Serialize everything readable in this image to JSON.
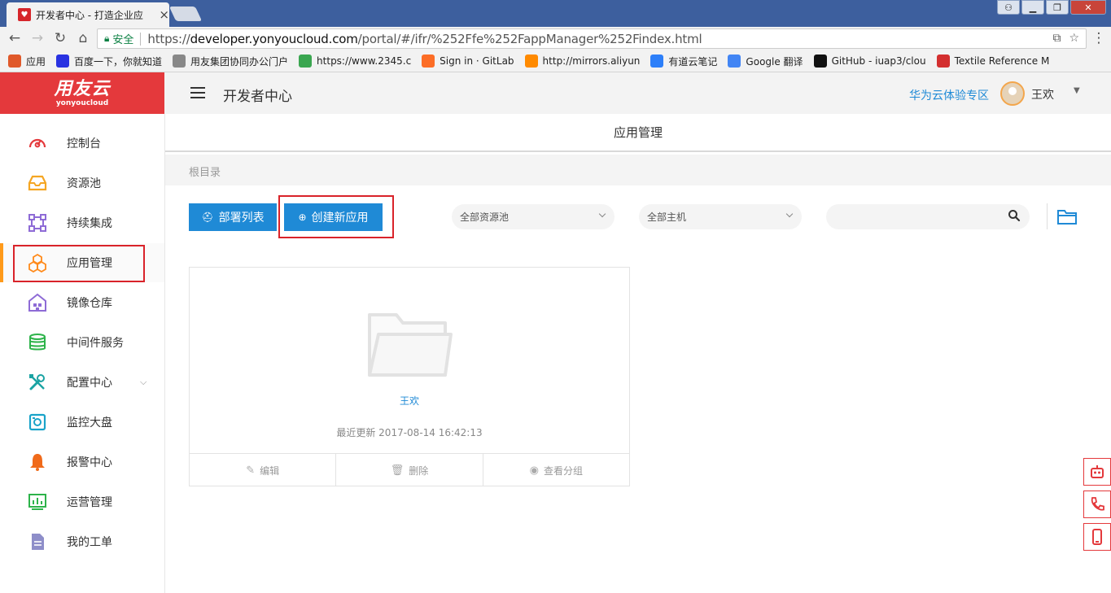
{
  "browser": {
    "tab_title": "开发者中心 - 打造企业应",
    "url_secure_label": "安全",
    "url_scheme": "https://",
    "url_host": "developer.yonyoucloud.com",
    "url_path": "/portal/#/ifr/%252Ffe%252FappManager%252Findex.html",
    "bookmarks": [
      {
        "label": "应用",
        "icon": "apps-grid-icon",
        "color": "#e0592a"
      },
      {
        "label": "百度一下，你就知道",
        "icon": "baidu-paw-icon",
        "color": "#2932e1"
      },
      {
        "label": "用友集团协同办公门户",
        "icon": "page-icon",
        "color": "#888888"
      },
      {
        "label": "https://www.2345.c",
        "icon": "2345-icon",
        "color": "#3aa650"
      },
      {
        "label": "Sign in · GitLab",
        "icon": "gitlab-fox-icon",
        "color": "#fc6d26"
      },
      {
        "label": "http://mirrors.aliyun",
        "icon": "aliyun-icon",
        "color": "#ff8a00"
      },
      {
        "label": "有道云笔记",
        "icon": "youdao-note-icon",
        "color": "#2d7ff9"
      },
      {
        "label": "Google 翻译",
        "icon": "google-translate-icon",
        "color": "#4285f4"
      },
      {
        "label": "GitHub - iuap3/clou",
        "icon": "github-icon",
        "color": "#111111"
      },
      {
        "label": "Textile Reference M",
        "icon": "textile-icon",
        "color": "#d32f2f"
      }
    ]
  },
  "brand": {
    "name_cn": "用友云",
    "name_en": "yonyoucloud",
    "color": "#e4393c"
  },
  "topbar": {
    "title": "开发者中心",
    "link": "华为云体验专区",
    "user_name": "王欢"
  },
  "sidebar": {
    "items": [
      {
        "label": "控制台",
        "icon": "dashboard-gauge-icon",
        "color": "#e4393c"
      },
      {
        "label": "资源池",
        "icon": "inbox-tray-icon",
        "color": "#f5a623"
      },
      {
        "label": "持续集成",
        "icon": "integration-nodes-icon",
        "color": "#8e6bd6"
      },
      {
        "label": "应用管理",
        "icon": "cubes-icon",
        "color": "#ff8a1a"
      },
      {
        "label": "镜像仓库",
        "icon": "warehouse-icon",
        "color": "#8e6bd6"
      },
      {
        "label": "中间件服务",
        "icon": "database-icon",
        "color": "#2db34a"
      },
      {
        "label": "配置中心",
        "icon": "tools-icon",
        "color": "#1aa3a3"
      },
      {
        "label": "监控大盘",
        "icon": "monitor-screen-icon",
        "color": "#1aa3c9"
      },
      {
        "label": "报警中心",
        "icon": "alarm-bell-icon",
        "color": "#f06a1a"
      },
      {
        "label": "运营管理",
        "icon": "operations-chart-icon",
        "color": "#2db34a"
      },
      {
        "label": "我的工单",
        "icon": "work-order-icon",
        "color": "#8e8ec9"
      }
    ]
  },
  "main": {
    "page_title": "应用管理",
    "breadcrumb": "根目录",
    "deploy_button": "部署列表",
    "create_button": "创建新应用",
    "pool_select": "全部资源池",
    "host_select": "全部主机",
    "search_value": "",
    "card": {
      "name": "王欢",
      "updated": "最近更新 2017-08-14 16:42:13",
      "actions": {
        "edit": "编辑",
        "delete": "删除",
        "view_group": "查看分组"
      }
    }
  },
  "colors": {
    "accent": "#1f8ad6",
    "annotation": "#d9232a",
    "active_marker": "#ff9a1a"
  }
}
